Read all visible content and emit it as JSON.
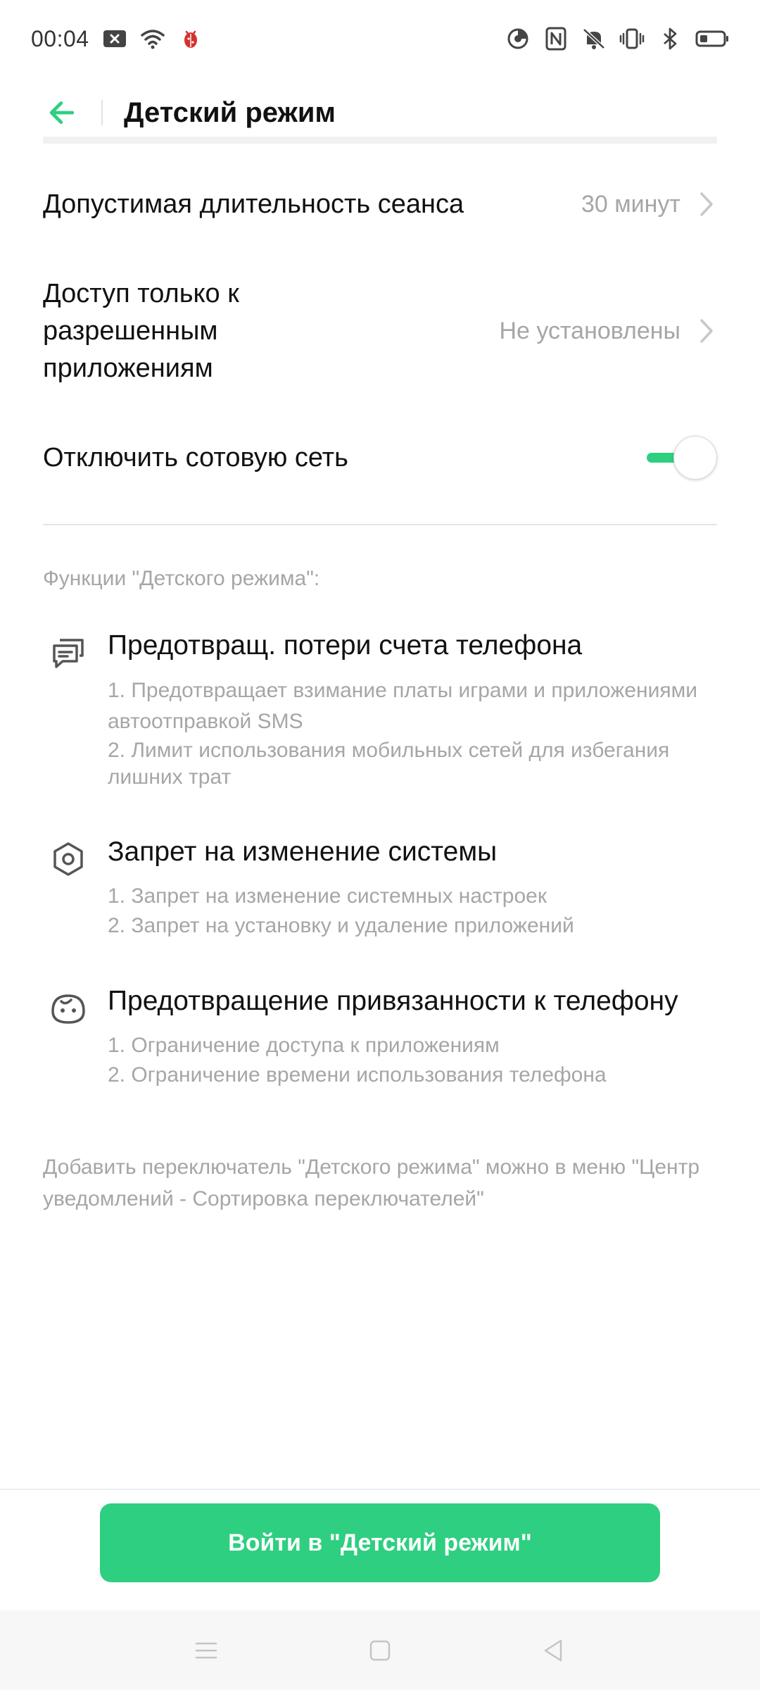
{
  "status_bar": {
    "time": "00:04",
    "left_icons": [
      "notification-close-icon",
      "wifi-icon",
      "bug-icon"
    ],
    "right_icons": [
      "data-saver-icon",
      "nfc-icon",
      "mute-icon",
      "vibrate-icon",
      "bluetooth-icon",
      "battery-icon"
    ]
  },
  "header": {
    "title": "Детский режим",
    "back_icon": "back-arrow-icon"
  },
  "settings": {
    "duration": {
      "label": "Допустимая длительность сеанса",
      "value": "30 минут"
    },
    "apps": {
      "label": "Доступ только к разрешенным приложениям",
      "value": "Не установлены"
    },
    "cellular": {
      "label": "Отключить сотовую сеть",
      "enabled": true
    }
  },
  "features": {
    "title": "Функции \"Детского режима\":",
    "items": [
      {
        "icon": "message-stack-icon",
        "title": "Предотвращ. потери счета телефона",
        "lines": [
          "1. Предотвращает взимание платы играми и приложениями автоотправкой SMS",
          "2. Лимит использования мобильных сетей для избегания лишних трат"
        ]
      },
      {
        "icon": "settings-nut-icon",
        "title": "Запрет на изменение системы",
        "lines": [
          "1. Запрет на изменение системных настроек",
          "2. Запрет на установку и удаление приложений"
        ]
      },
      {
        "icon": "child-face-icon",
        "title": "Предотвращение привязанности к телефону",
        "lines": [
          "1. Ограничение доступа к приложениям",
          "2. Ограничение времени использования телефона"
        ]
      }
    ]
  },
  "footnote": "Добавить переключатель \"Детского режима\" можно в меню \"Центр уведомлений - Сортировка переключателей\"",
  "action": {
    "enter_label": "Войти в \"Детский режим\""
  },
  "colors": {
    "accent": "#2ecf80",
    "secondary_text": "#a6a6a6",
    "primary_text": "#111111"
  },
  "nav": [
    "menu-icon",
    "home-icon",
    "back-icon"
  ]
}
